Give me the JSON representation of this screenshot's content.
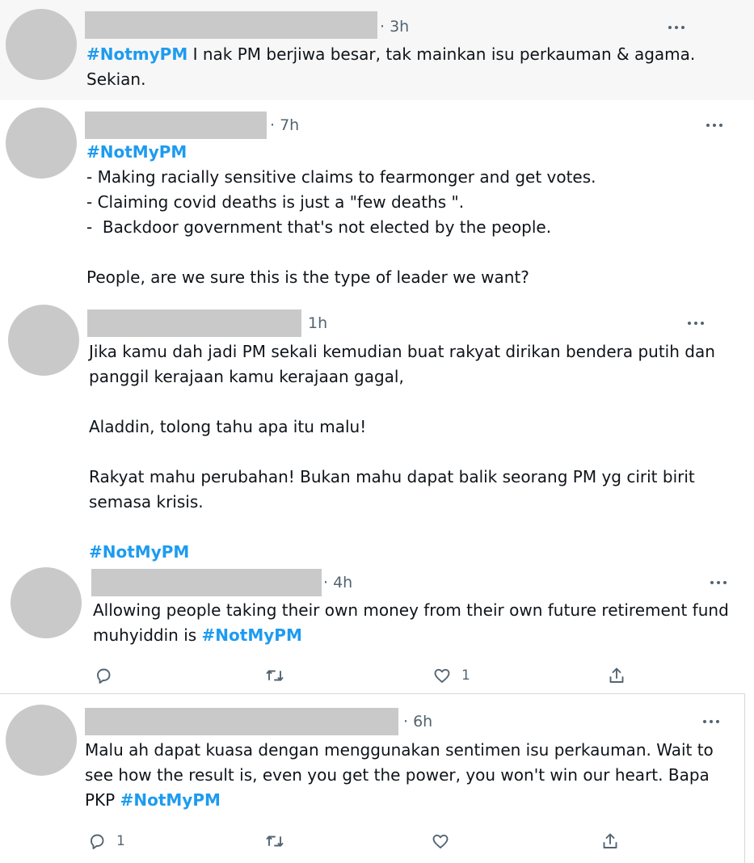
{
  "tweets": [
    {
      "time": "· 3h",
      "segments": [
        {
          "text": "#NotmyPM",
          "hashtag": true
        },
        {
          "text": " I nak PM berjiwa besar, tak mainkan isu perkauman & agama. Sekian.",
          "hashtag": false
        }
      ]
    },
    {
      "time": "· 7h",
      "segments": [
        {
          "text": "#NotMyPM",
          "hashtag": true
        },
        {
          "text": "\n- Making racially sensitive claims to fearmonger and get votes.\n- Claiming covid deaths is just a \"few deaths \".\n-  Backdoor government that's not elected by the people.\n\nPeople, are we sure this is the type of leader we want?",
          "hashtag": false
        }
      ]
    },
    {
      "time": "1h",
      "segments": [
        {
          "text": "Jika kamu dah jadi PM sekali kemudian buat rakyat dirikan bendera putih dan panggil kerajaan kamu kerajaan gagal,\n\nAladdin, tolong tahu apa itu malu!\n\nRakyat mahu perubahan! Bukan mahu dapat balik seorang PM yg cirit birit semasa krisis.\n\n",
          "hashtag": false
        },
        {
          "text": "#NotMyPM",
          "hashtag": true
        }
      ]
    },
    {
      "time": "· 4h",
      "segments": [
        {
          "text": "Allowing people taking their own money from their own future retirement fund muhyiddin is ",
          "hashtag": false
        },
        {
          "text": "#NotMyPM",
          "hashtag": true
        }
      ],
      "actions": {
        "reply": "",
        "retweet": "",
        "like": "1",
        "share": ""
      }
    },
    {
      "time": "· 6h",
      "segments": [
        {
          "text": "Malu ah dapat kuasa dengan menggunakan sentimen isu perkauman. Wait to see how the result is, even you get the power, you won't win our heart. Bapa PKP ",
          "hashtag": false
        },
        {
          "text": "#NotMyPM",
          "hashtag": true
        }
      ],
      "actions": {
        "reply": "1",
        "retweet": "",
        "like": "",
        "share": ""
      }
    }
  ],
  "icons": {
    "reply": "reply-icon",
    "retweet": "retweet-icon",
    "like": "like-icon",
    "share": "share-icon",
    "more": "more-options-icon"
  },
  "colors": {
    "hashtag": "#1d9bf0",
    "muted": "#536471",
    "highlight_bg": "#f7f7f7",
    "placeholder": "#c9c9c9"
  }
}
